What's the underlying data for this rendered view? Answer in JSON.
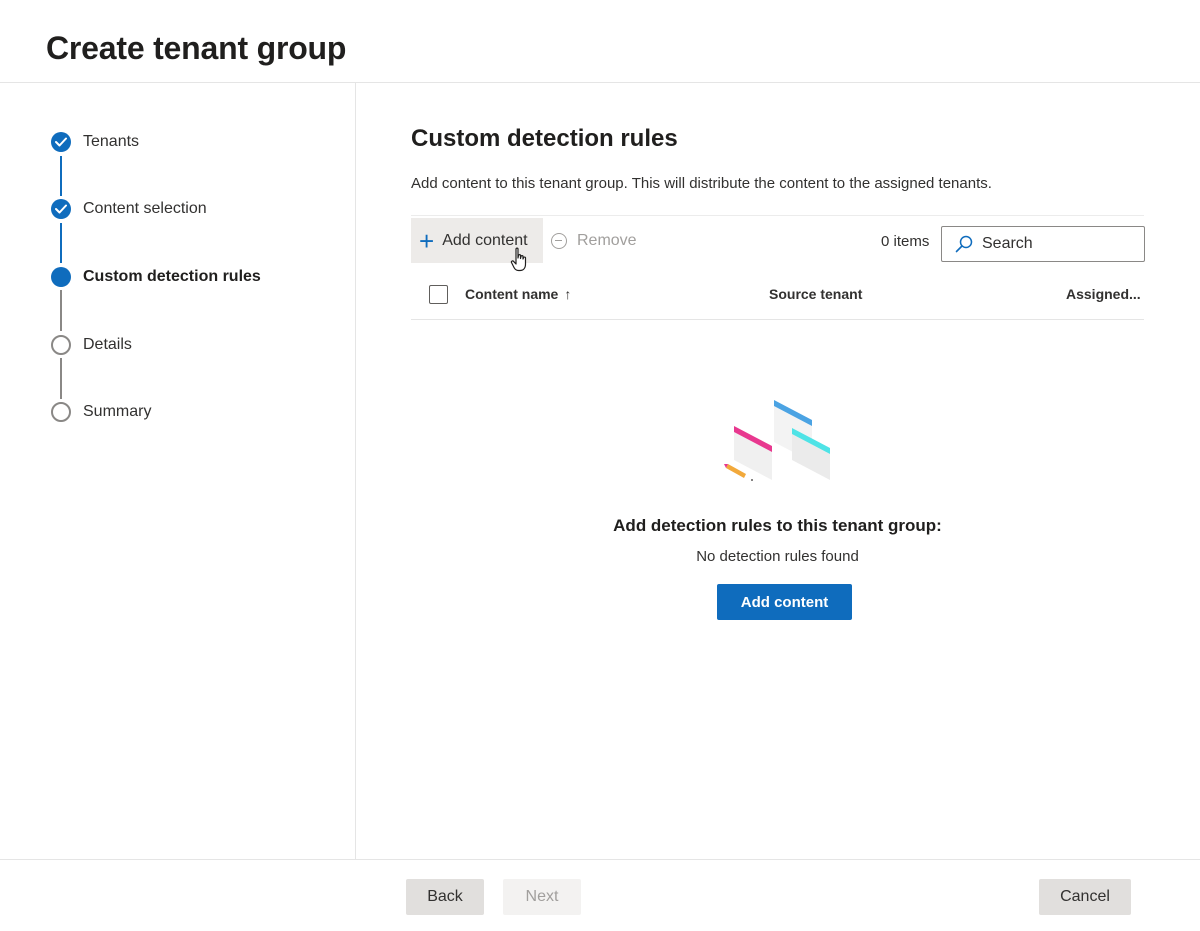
{
  "page": {
    "title": "Create tenant group"
  },
  "steps": [
    {
      "label": "Tenants",
      "state": "done"
    },
    {
      "label": "Content selection",
      "state": "done"
    },
    {
      "label": "Custom detection rules",
      "state": "current"
    },
    {
      "label": "Details",
      "state": "pending"
    },
    {
      "label": "Summary",
      "state": "pending"
    }
  ],
  "main": {
    "title": "Custom detection rules",
    "description": "Add content to this tenant group. This will distribute the content to the assigned tenants.",
    "toolbar": {
      "add_label": "Add content",
      "remove_label": "Remove",
      "items_count": "0 items",
      "search_placeholder": "Search"
    },
    "table": {
      "columns": [
        "Content name",
        "Source tenant",
        "Assigned..."
      ],
      "sort_arrow": "↑"
    },
    "empty_state": {
      "title": "Add detection rules to this tenant group:",
      "subtitle": "No detection rules found",
      "button_label": "Add content"
    }
  },
  "footer": {
    "back_label": "Back",
    "next_label": "Next",
    "cancel_label": "Cancel"
  },
  "colors": {
    "accent": "#0f6cbd",
    "illustration_pink": "#e8388f",
    "illustration_blue": "#4ba3e3",
    "illustration_cyan": "#4fe3e6",
    "illustration_pencil": "#f2a93b"
  }
}
